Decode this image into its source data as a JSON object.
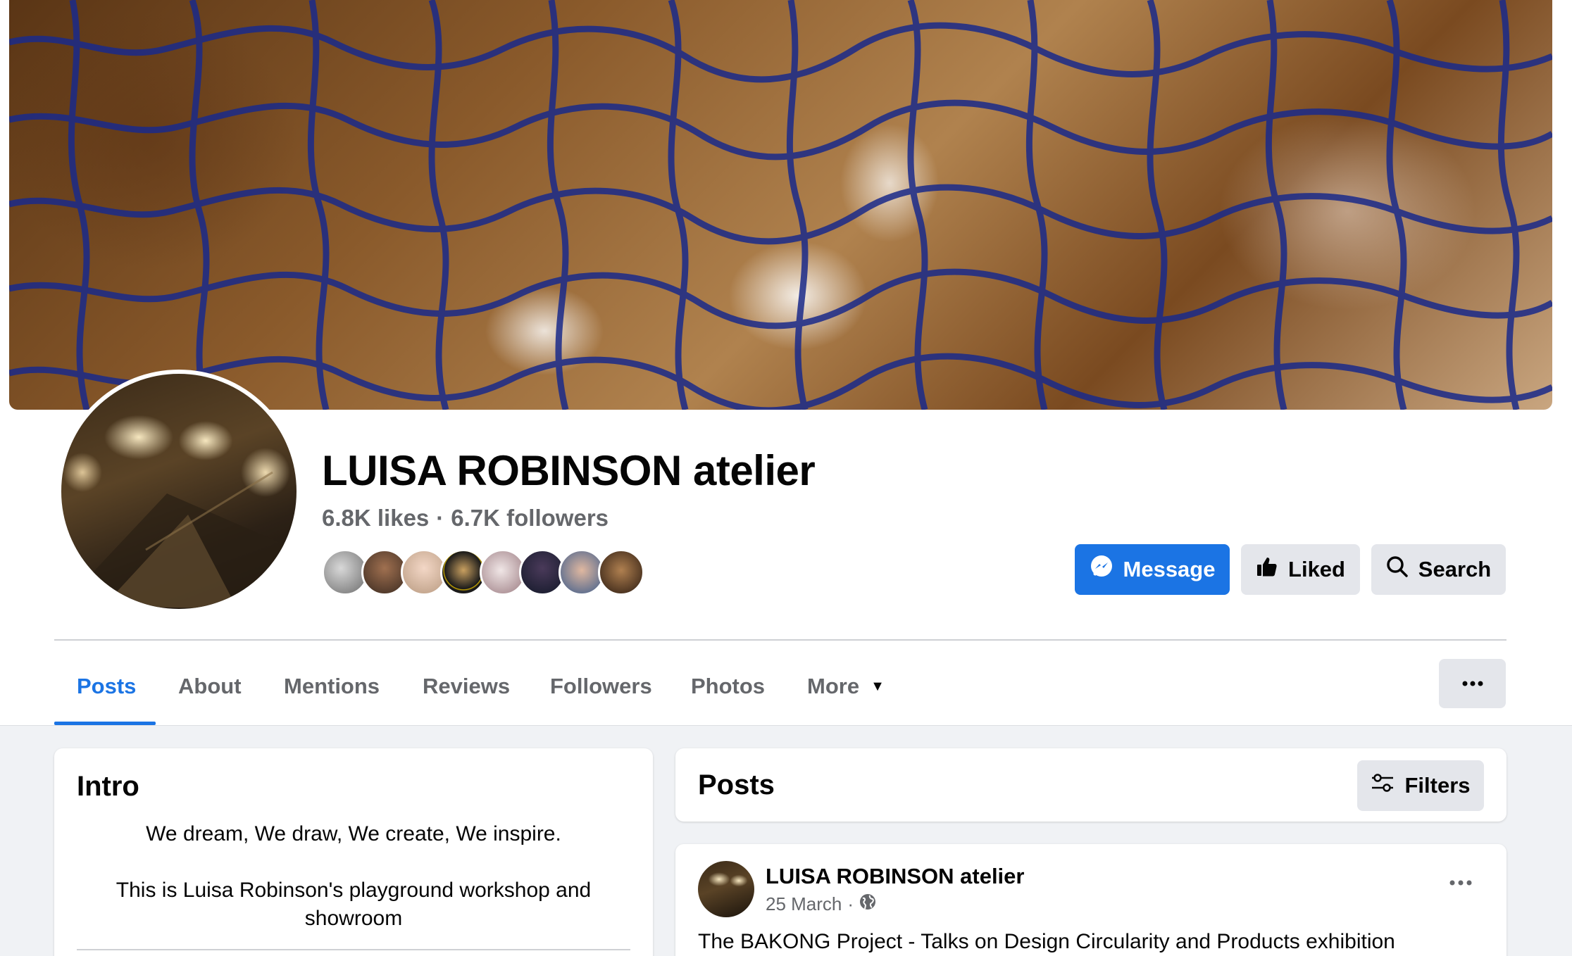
{
  "page": {
    "name": "LUISA ROBINSON atelier",
    "likes": "6.8K likes",
    "separator": "·",
    "followers": "6.7K followers"
  },
  "actions": {
    "message_label": "Message",
    "liked_label": "Liked",
    "search_label": "Search"
  },
  "tabs": [
    {
      "label": "Posts",
      "active": true
    },
    {
      "label": "About"
    },
    {
      "label": "Mentions"
    },
    {
      "label": "Reviews"
    },
    {
      "label": "Followers"
    },
    {
      "label": "Photos"
    },
    {
      "label": "More"
    }
  ],
  "intro": {
    "title": "Intro",
    "line1": "We dream, We draw, We create, We inspire.",
    "line2": "This is Luisa Robinson's playground workshop and showroom"
  },
  "posts_section": {
    "title": "Posts",
    "filters_label": "Filters"
  },
  "post": {
    "author": "LUISA ROBINSON atelier",
    "date": "25 March",
    "meta_separator": "·",
    "privacy_icon": "globe-icon",
    "text": "The BAKONG Project - Talks on Design Circularity and Products exhibition"
  },
  "colors": {
    "accent": "#1b74e4",
    "secondary_text": "#65676b",
    "button_gray": "#e4e6eb",
    "background": "#f0f2f5"
  },
  "icons": {
    "message": "messenger-icon",
    "liked": "thumbs-up-icon",
    "search": "search-icon",
    "more_caret": "caret-down-icon",
    "overflow": "more-horizontal-icon",
    "filters": "sliders-icon"
  }
}
